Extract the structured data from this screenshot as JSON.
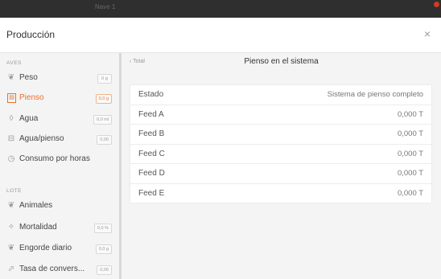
{
  "window": {
    "title": "Nave 1"
  },
  "modal": {
    "title": "Producción",
    "close": "×"
  },
  "sidebar": {
    "sections": [
      {
        "label": "AVES"
      },
      {
        "label": "LOTE"
      }
    ],
    "items": [
      {
        "label": "Peso",
        "badge": "0 g",
        "icon": "bird-icon"
      },
      {
        "label": "Pienso",
        "badge": "0,0 g",
        "icon": "feed-icon",
        "active": true
      },
      {
        "label": "Agua",
        "badge": "0,0 ml",
        "icon": "water-drop-icon"
      },
      {
        "label": "Agua/pienso",
        "badge": "0,00",
        "icon": "ratio-icon"
      },
      {
        "label": "Consumo por horas",
        "badge": "",
        "icon": "clock-icon"
      },
      {
        "label": "Animales",
        "badge": "",
        "icon": "bird-icon"
      },
      {
        "label": "Mortalidad",
        "badge": "0,0 %",
        "icon": "mortality-icon"
      },
      {
        "label": "Engorde diario",
        "badge": "0,0 g",
        "icon": "growth-icon"
      },
      {
        "label": "Tasa de convers...",
        "badge": "0,00",
        "icon": "conversion-icon"
      }
    ]
  },
  "main": {
    "back_label": "‹ Total",
    "title": "Pienso en el sistema",
    "table": [
      {
        "key": "Estado",
        "value": "Sistema de pienso completo"
      },
      {
        "key": "Feed A",
        "value": "0,000 T"
      },
      {
        "key": "Feed B",
        "value": "0,000 T"
      },
      {
        "key": "Feed C",
        "value": "0,000 T"
      },
      {
        "key": "Feed D",
        "value": "0,000 T"
      },
      {
        "key": "Feed E",
        "value": "0,000 T"
      }
    ]
  },
  "colors": {
    "accent": "#e8722e",
    "panel": "#f4f4f4",
    "window_close": "#d23a22"
  }
}
